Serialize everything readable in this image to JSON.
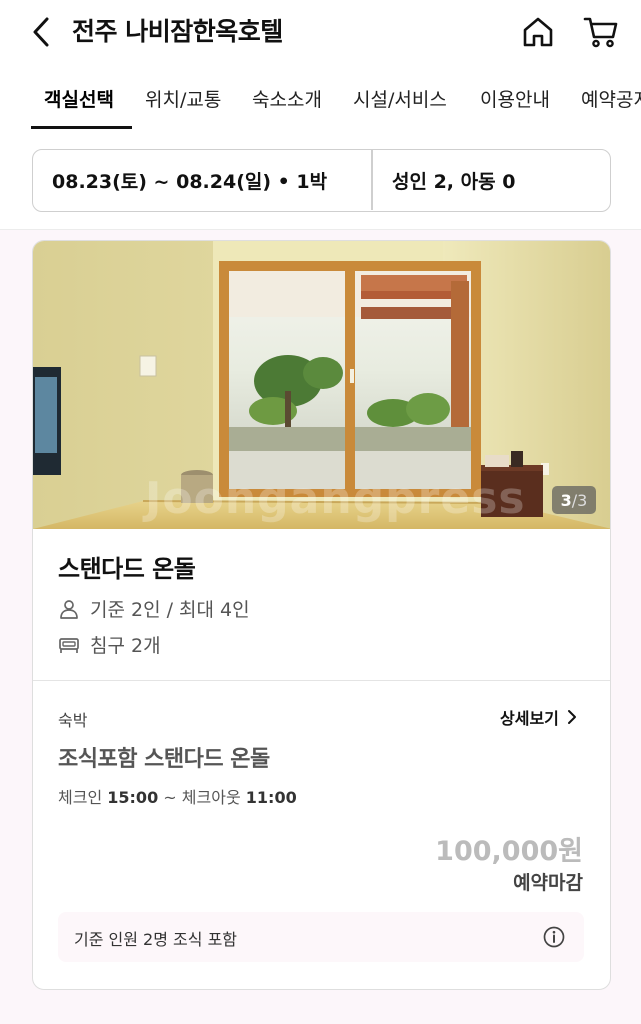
{
  "header": {
    "title": "전주 나비잠한옥호텔"
  },
  "tabs": [
    {
      "label": "객실선택",
      "active": true
    },
    {
      "label": "위치/교통"
    },
    {
      "label": "숙소소개"
    },
    {
      "label": "시설/서비스"
    },
    {
      "label": "이용안내"
    },
    {
      "label": "예약공지"
    }
  ],
  "search": {
    "dates": "08.23(토) ~ 08.24(일) • 1박",
    "guests": "성인 2, 아동 0"
  },
  "room": {
    "photo_current": "3",
    "photo_total": "/3",
    "watermark": "Joongangpress",
    "name": "스탠다드 온돌",
    "capacity": "기준 2인 / 최대 4인",
    "beds": "침구 2개"
  },
  "plan": {
    "type_label": "숙박",
    "detail_link": "상세보기",
    "name": "조식포함 스탠다드 온돌",
    "checkin_label": "체크인",
    "checkin_time": "15:00",
    "tilde": "~",
    "checkout_label": "체크아웃",
    "checkout_time": "11:00",
    "price": "100,000원",
    "status": "예약마감",
    "notice": "기준 인원 2명 조식 포함"
  },
  "icons": [
    "back-arrow-icon",
    "home-icon",
    "cart-icon",
    "person-icon",
    "bed-icon",
    "chevron-right-icon",
    "info-icon"
  ],
  "colors": {
    "background": "#fcf6fa",
    "price_disabled": "#bbbbbb",
    "notice_bg": "#fdf7fa"
  }
}
